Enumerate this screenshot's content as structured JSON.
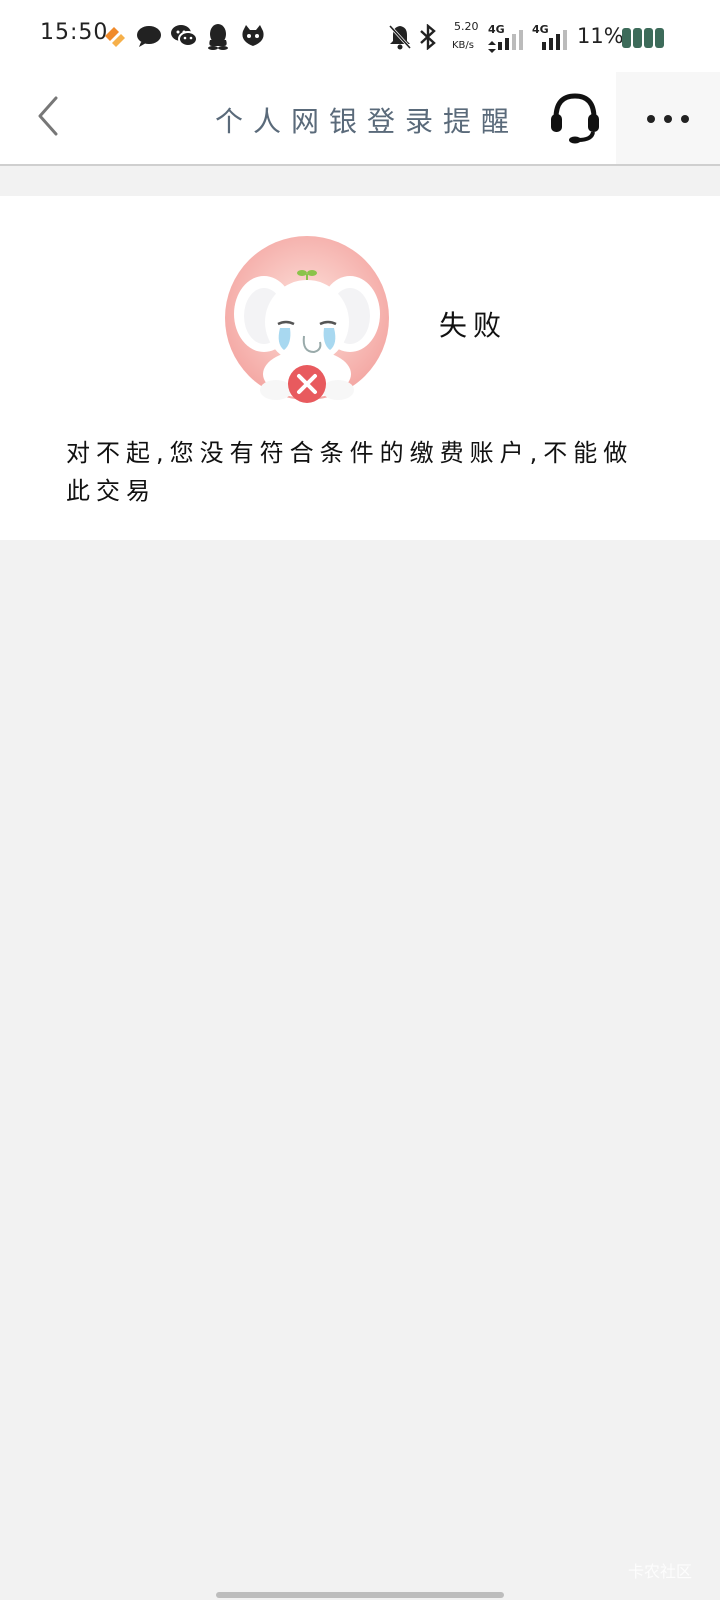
{
  "status_bar": {
    "time": "15:50",
    "net_speed_value": "5.20",
    "net_speed_unit": "KB/s",
    "net1_label": "4G",
    "net2_label": "4G",
    "battery_percent": "11%",
    "battery_level": 0.11,
    "icons": [
      "app-orange-icon",
      "message-bubble-icon",
      "wechat-icon",
      "qq-icon",
      "cat-icon",
      "mute-bell-icon",
      "bluetooth-icon",
      "signal-icon",
      "battery-icon"
    ]
  },
  "nav": {
    "title": "个人网银登录提醒",
    "back_icon": "chevron-left-icon",
    "service_icon": "headset-icon",
    "more_icon": "more-dots-icon"
  },
  "result": {
    "status_label": "失败",
    "message": "对不起,您没有符合条件的缴费账户,不能做此交易"
  },
  "watermark": "卡农社区",
  "colors": {
    "title": "#5a6a7a",
    "error_red": "#e85a5e",
    "mascot_bg": "#f4a8a4",
    "page_bg": "#f2f2f2"
  }
}
